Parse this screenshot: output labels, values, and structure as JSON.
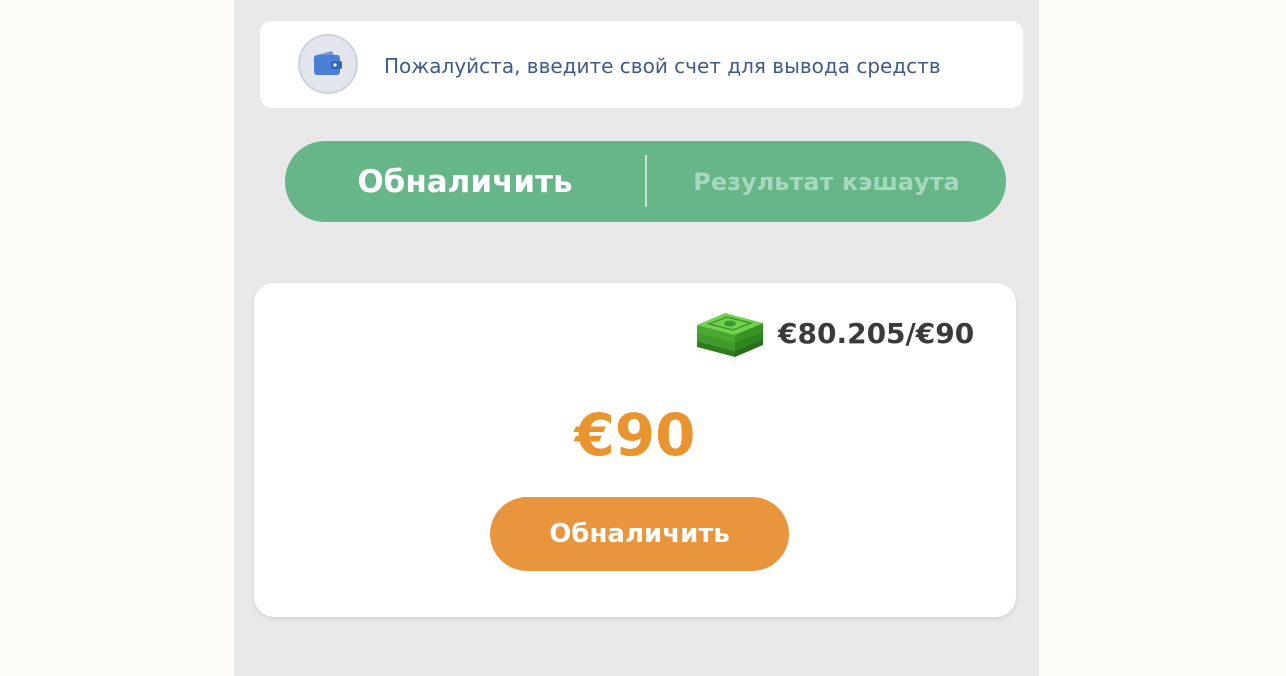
{
  "account": {
    "icon": "wallet-icon",
    "prompt": "Пожалуйста, введите свой счет для вывода средств"
  },
  "tabs": [
    {
      "label": "Обналичить",
      "active": true
    },
    {
      "label": "Результат кэшаута",
      "active": false
    }
  ],
  "cashout": {
    "money_icon": "cash-stack-icon",
    "balance": "€80.205/€90",
    "amount": "€90",
    "button_label": "Обналичить"
  },
  "colors": {
    "app_background": "#e9e9e9",
    "tab_green": "#67b689",
    "accent_orange": "#e8952f",
    "wallet_blue": "#4a7fd4"
  }
}
